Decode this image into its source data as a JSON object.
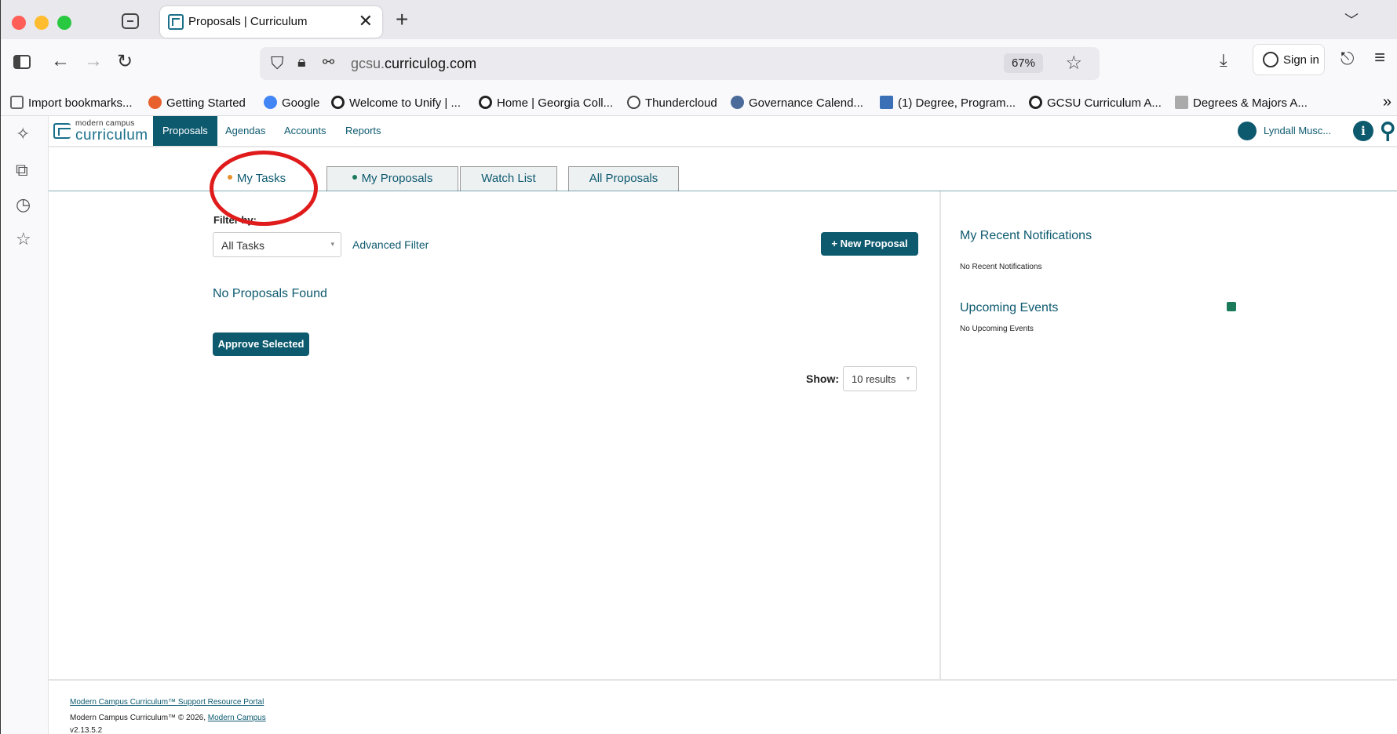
{
  "browser": {
    "tab_title": "Proposals | Curriculum",
    "tab_close": "✕",
    "new_tab": "+",
    "url_host_prefix": "gcsu.",
    "url_host_main": "curriculog.com",
    "zoom": "67%",
    "signin_label": "Sign in"
  },
  "bookmarks": [
    {
      "label": "Import bookmarks...",
      "color": "#666"
    },
    {
      "label": "Getting Started",
      "color": "#e8612c"
    },
    {
      "label": "Google",
      "color": "#4285f4"
    },
    {
      "label": "Welcome to Unify | ...",
      "color": "#222"
    },
    {
      "label": "Home | Georgia Coll...",
      "color": "#222"
    },
    {
      "label": "Thundercloud",
      "color": "#444"
    },
    {
      "label": "Governance Calend...",
      "color": "#4a6b9a"
    },
    {
      "label": "(1) Degree, Program...",
      "color": "#3b6fb6"
    },
    {
      "label": "GCSU Curriculum A...",
      "color": "#222"
    },
    {
      "label": "Degrees & Majors A...",
      "color": "#aaa"
    }
  ],
  "app": {
    "logo_small": "modern campus",
    "logo_big": "curriculum",
    "nav": [
      {
        "label": "Proposals",
        "active": true
      },
      {
        "label": "Agendas",
        "active": false
      },
      {
        "label": "Accounts",
        "active": false
      },
      {
        "label": "Reports",
        "active": false
      }
    ],
    "user_name": "Lyndall Musc...",
    "info_glyph": "i"
  },
  "tabs": [
    {
      "label": "My Tasks",
      "dot_color": "#e8912c",
      "active": true
    },
    {
      "label": "My Proposals",
      "dot_color": "#1a7a5a",
      "active": false
    },
    {
      "label": "Watch List",
      "dot_color": null,
      "active": false
    },
    {
      "label": "All Proposals",
      "dot_color": null,
      "active": false
    }
  ],
  "main": {
    "filter_label": "Filter by:",
    "filter_value": "All Tasks",
    "advanced_filter": "Advanced Filter",
    "new_proposal": "+ New Proposal",
    "no_proposals": "No Proposals Found",
    "approve_selected": "Approve Selected",
    "show_label": "Show:",
    "show_value": "10 results"
  },
  "right": {
    "notifications_title": "My Recent Notifications",
    "notifications_empty": "No Recent Notifications",
    "events_title": "Upcoming Events",
    "events_empty": "No Upcoming Events"
  },
  "footer": {
    "support_link": "Modern Campus Curriculum™ Support Resource Portal",
    "copyright": "Modern Campus Curriculum™ © 2026, ",
    "company_link": "Modern Campus",
    "version": "v2.13.5.2"
  },
  "colors": {
    "brand": "#0d5a6f",
    "annotation": "#e01b1b"
  }
}
